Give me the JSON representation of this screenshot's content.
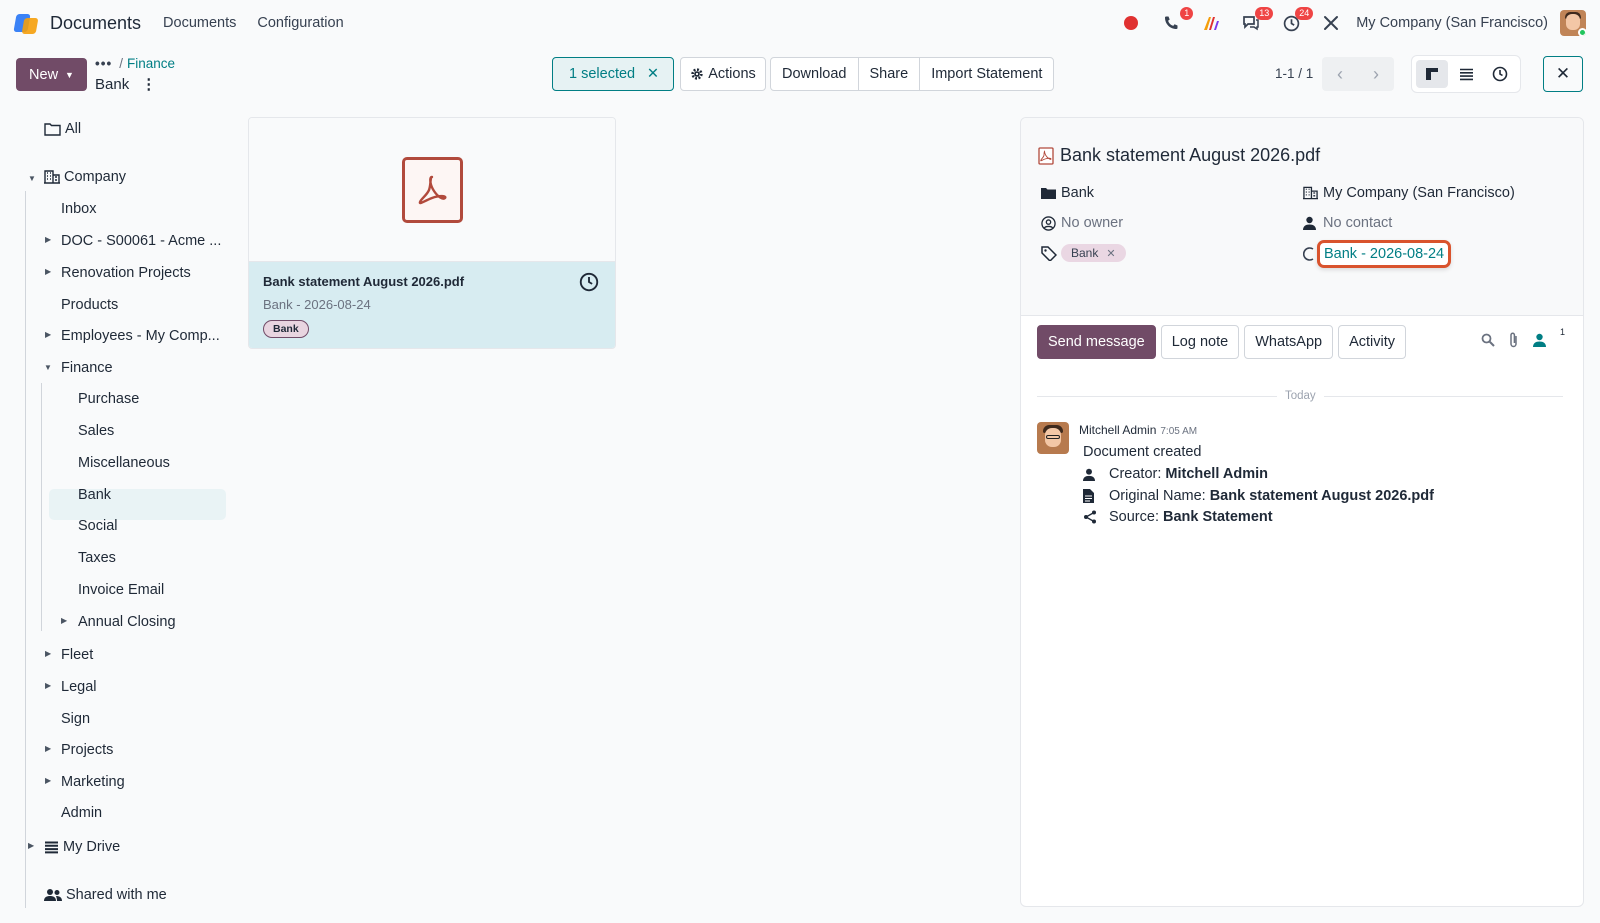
{
  "navbar": {
    "app_name": "Documents",
    "menu": [
      "Documents",
      "Configuration"
    ],
    "badges": {
      "calls": "1",
      "messages": "13",
      "activities": "24"
    },
    "company": "My Company (San Francisco)"
  },
  "control_panel": {
    "new_label": "New",
    "breadcrumb_parent": "Finance",
    "breadcrumb_current": "Bank",
    "selected_label": "1 selected",
    "actions_label": "Actions",
    "download_label": "Download",
    "share_label": "Share",
    "import_label": "Import Statement",
    "pager": "1-1 / 1"
  },
  "sidebar": {
    "all": "All",
    "company": "Company",
    "company_children": [
      "Inbox",
      "DOC - S00061 - Acme ...",
      "Renovation Projects",
      "Products",
      "Employees - My Comp...",
      "Finance"
    ],
    "finance_children": [
      "Purchase",
      "Sales",
      "Miscellaneous",
      "Bank",
      "Social",
      "Taxes",
      "Invoice Email",
      "Annual Closing"
    ],
    "after_finance": [
      "Fleet",
      "Legal",
      "Sign",
      "Projects",
      "Marketing",
      "Admin"
    ],
    "my_drive": "My Drive",
    "shared": "Shared with me"
  },
  "card": {
    "title": "Bank statement August 2026.pdf",
    "subtitle": "Bank - 2026-08-24",
    "tag": "Bank"
  },
  "panel": {
    "title": "Bank statement August 2026.pdf",
    "folder": "Bank",
    "company": "My Company (San Francisco)",
    "owner": "No owner",
    "contact": "No contact",
    "tag": "Bank",
    "link": "Bank - 2026-08-24"
  },
  "chatter": {
    "send": "Send message",
    "log": "Log note",
    "whatsapp": "WhatsApp",
    "activity": "Activity",
    "followers": "1",
    "today": "Today",
    "author": "Mitchell Admin",
    "time": "7:05 AM",
    "body": "Document created",
    "creator_label": "Creator:",
    "creator_value": "Mitchell Admin",
    "orig_label": "Original Name:",
    "orig_value": "Bank statement August 2026.pdf",
    "source_label": "Source:",
    "source_value": "Bank Statement"
  }
}
